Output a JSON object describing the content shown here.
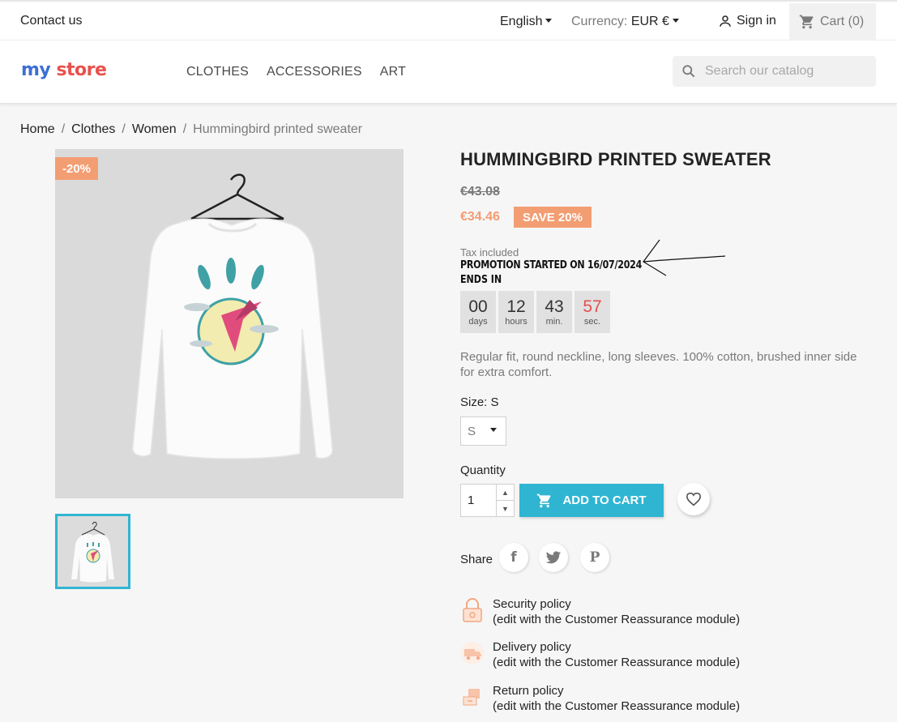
{
  "topbar": {
    "contact": "Contact us",
    "language": "English",
    "currency_label": "Currency:",
    "currency_value": "EUR €",
    "sign_in": "Sign in",
    "cart": "Cart (0)"
  },
  "header": {
    "logo_my": "my",
    "logo_store": "store",
    "nav": [
      "CLOTHES",
      "ACCESSORIES",
      "ART"
    ],
    "search_placeholder": "Search our catalog"
  },
  "breadcrumb": [
    "Home",
    "Clothes",
    "Women",
    "Hummingbird printed sweater"
  ],
  "product": {
    "discount_flag": "-20%",
    "title": "HUMMINGBIRD PRINTED SWEATER",
    "old_price": "€43.08",
    "new_price": "€34.46",
    "save_badge": "SAVE 20%",
    "tax": "Tax included",
    "promo_start": "PROMOTION STARTED ON 16/07/2024",
    "promo_ends": "ENDS IN",
    "countdown": [
      {
        "value": "00",
        "unit": "days"
      },
      {
        "value": "12",
        "unit": "hours"
      },
      {
        "value": "43",
        "unit": "min."
      },
      {
        "value": "57",
        "unit": "sec."
      }
    ],
    "description": "Regular fit, round neckline, long sleeves. 100% cotton, brushed inner side for extra comfort.",
    "size_label": "Size: S",
    "size_value": "S",
    "quantity_label": "Quantity",
    "quantity_value": "1",
    "add_to_cart": "ADD TO CART",
    "share_label": "Share"
  },
  "reassurance": [
    {
      "title": "Security policy",
      "sub": "(edit with the Customer Reassurance module)",
      "icon": "lock-icon"
    },
    {
      "title": "Delivery policy",
      "sub": "(edit with the Customer Reassurance module)",
      "icon": "truck-icon"
    },
    {
      "title": "Return policy",
      "sub": "(edit with the Customer Reassurance module)",
      "icon": "return-box-icon"
    }
  ],
  "colors": {
    "accent": "#2fb5d2",
    "discount": "#f39d72",
    "countdown_seconds": "#e34f4f"
  }
}
